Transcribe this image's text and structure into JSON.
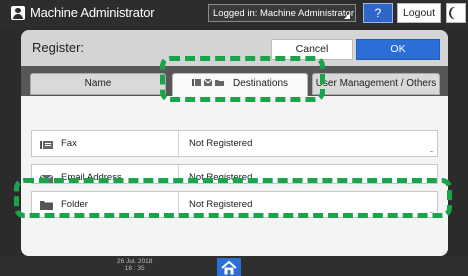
{
  "topbar": {
    "title": "Machine Administrator",
    "login_status": "Logged in: Machine Administrator",
    "help_label": "?",
    "logout_label": "Logout"
  },
  "dialog": {
    "title": "Register:",
    "cancel_label": "Cancel",
    "ok_label": "OK",
    "tabs": [
      {
        "label": "Name",
        "active": false
      },
      {
        "label": "Destinations",
        "active": true
      },
      {
        "label": "User Management / Others",
        "active": false
      }
    ],
    "rows": [
      {
        "label": "Fax",
        "value": "Not Registered",
        "icon": "fax-icon"
      },
      {
        "label": "Email Address",
        "value": "Not Registered",
        "icon": "email-icon"
      },
      {
        "label": "Folder",
        "value": "Not Registered",
        "icon": "folder-icon"
      }
    ]
  },
  "bottombar": {
    "date": "26 Jul. 2018",
    "time": "18 : 35",
    "home_icon": "home-icon"
  },
  "colors": {
    "accent": "#2b6fd6",
    "highlight": "#1aa44a"
  }
}
